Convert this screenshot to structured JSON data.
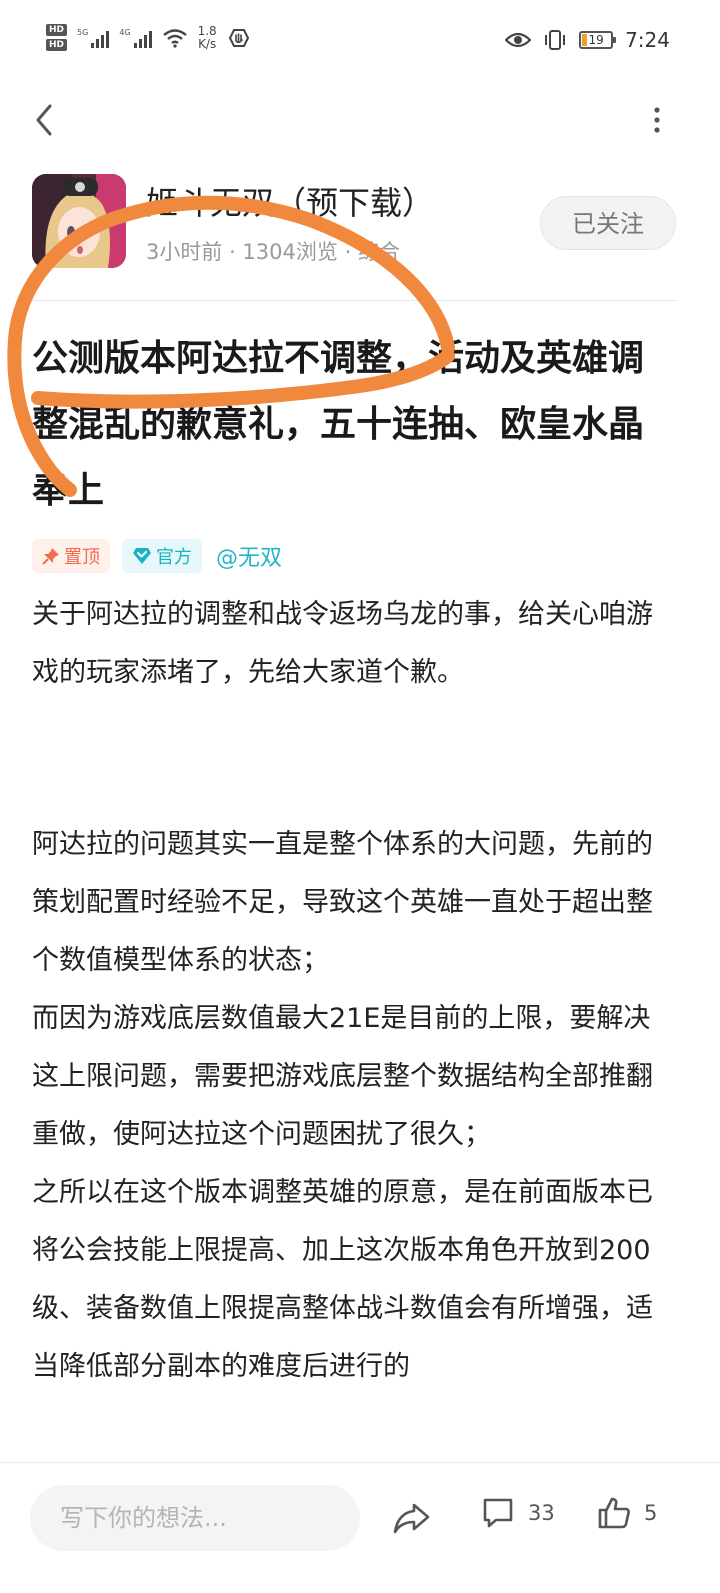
{
  "status_bar": {
    "net_speed_value": "1.8",
    "net_speed_unit": "K/s",
    "signal_1_label": "5G",
    "signal_2_label": "4G",
    "battery": "19",
    "time": "7:24"
  },
  "header": {
    "app_name": "姬斗无双（预下载）",
    "time_ago": "3小时前",
    "views": "1304浏览",
    "category": "综合",
    "follow_label": "已关注"
  },
  "post": {
    "title": "公测版本阿达拉不调整，活动及英雄调整混乱的歉意礼，五十连抽、欧皇水晶奉上",
    "tags": {
      "pin": "置顶",
      "official": "官方",
      "mention": "@无双"
    },
    "paragraph_1": "关于阿达拉的调整和战令返场乌龙的事，给关心咱游戏的玩家添堵了，先给大家道个歉。",
    "paragraph_2_lines": [
      "阿达拉的问题其实一直是整个体系的大问题，先前的策划配置时经验不足，导致这个英雄一直处于超出整个数值模型体系的状态；",
      "而因为游戏底层数值最大21E是目前的上限，要解决这上限问题，需要把游戏底层整个数据结构全部推翻重做，使阿达拉这个问题困扰了很久；",
      "之所以在这个版本调整英雄的原意，是在前面版本已将公会技能上限提高、加上这次版本角色开放到200级、装备数值上限提高整体战斗数值会有所增强，适当降低部分副本的难度后进行的"
    ]
  },
  "bottom_bar": {
    "comment_placeholder": "写下你的想法...",
    "comment_count": "33",
    "like_count": "5"
  },
  "colors": {
    "annotation": "#f0883e",
    "accent_teal": "#20b6c8",
    "pin_red": "#f26b4b"
  }
}
